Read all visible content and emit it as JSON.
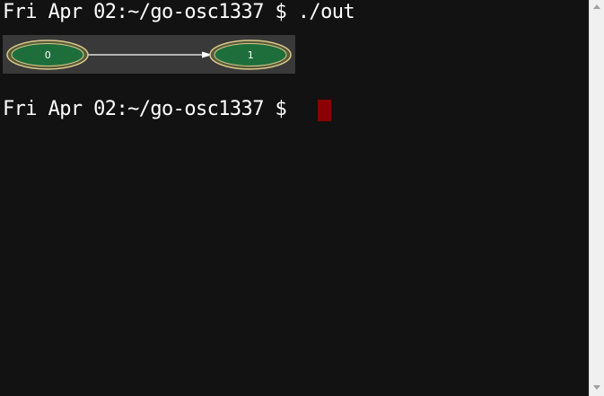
{
  "terminal": {
    "line1": "Fri Apr 02:~/go-osc1337 $ ./out",
    "line2": "Fri Apr 02:~/go-osc1337 $ ",
    "cursor_color": "#8b0000",
    "background": "#121212"
  },
  "graph": {
    "nodes": [
      {
        "id": "node0",
        "label": "0"
      },
      {
        "id": "node1",
        "label": "1"
      }
    ],
    "edge": {
      "from": "0",
      "to": "1"
    },
    "node_fill": "#1e6e3c",
    "node_stroke": "#d8c98a",
    "edge_color": "#ffffff"
  },
  "scrollbar": {
    "up_icon": "triangle-up-icon",
    "down_icon": "triangle-down-icon"
  }
}
